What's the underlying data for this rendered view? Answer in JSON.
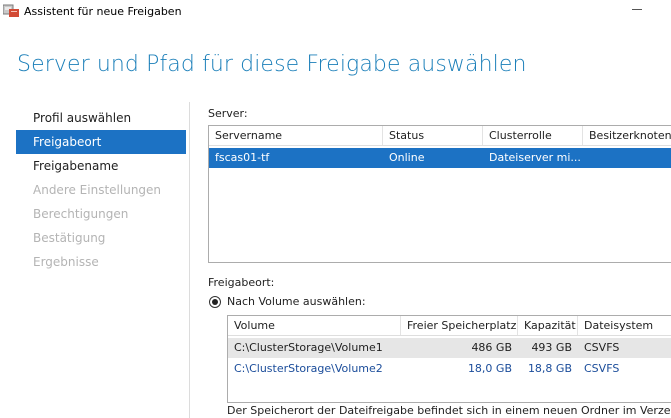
{
  "window": {
    "title": "Assistent für neue Freigaben",
    "icon": "share-folder-icon"
  },
  "page": {
    "title": "Server und Pfad für diese Freigabe auswählen"
  },
  "nav": {
    "items": [
      {
        "label": "Profil auswählen",
        "state": "done"
      },
      {
        "label": "Freigabeort",
        "state": "active"
      },
      {
        "label": "Freigabename",
        "state": "done"
      },
      {
        "label": "Andere Einstellungen",
        "state": "disabled"
      },
      {
        "label": "Berechtigungen",
        "state": "disabled"
      },
      {
        "label": "Bestätigung",
        "state": "disabled"
      },
      {
        "label": "Ergebnisse",
        "state": "disabled"
      }
    ]
  },
  "server_section": {
    "label": "Server:",
    "columns": [
      "Servername",
      "Status",
      "Clusterrolle",
      "Besitzerknoten"
    ],
    "rows": [
      {
        "servername": "fscas01-tf",
        "status": "Online",
        "clusterrolle": "Dateiserver mi...",
        "besitzerknoten": ""
      }
    ]
  },
  "location_section": {
    "label": "Freigabeort:",
    "radio_label": "Nach Volume auswählen:",
    "radio_selected": true,
    "columns": [
      "Volume",
      "Freier Speicherplatz",
      "Kapazität",
      "Dateisystem"
    ],
    "rows": [
      {
        "volume": "C:\\ClusterStorage\\Volume1",
        "free": "486 GB",
        "capacity": "493 GB",
        "fs": "CSVFS"
      },
      {
        "volume": "C:\\ClusterStorage\\Volume2",
        "free": "18,0 GB",
        "capacity": "18,8 GB",
        "fs": "CSVFS"
      }
    ],
    "note": "Der Speicherort der Dateifreigabe befindet sich in einem neuen Ordner im Verzeichnis"
  },
  "colors": {
    "accent": "#1c72c4",
    "title": "#1b7fb9",
    "disabled": "#b4b4b4"
  }
}
